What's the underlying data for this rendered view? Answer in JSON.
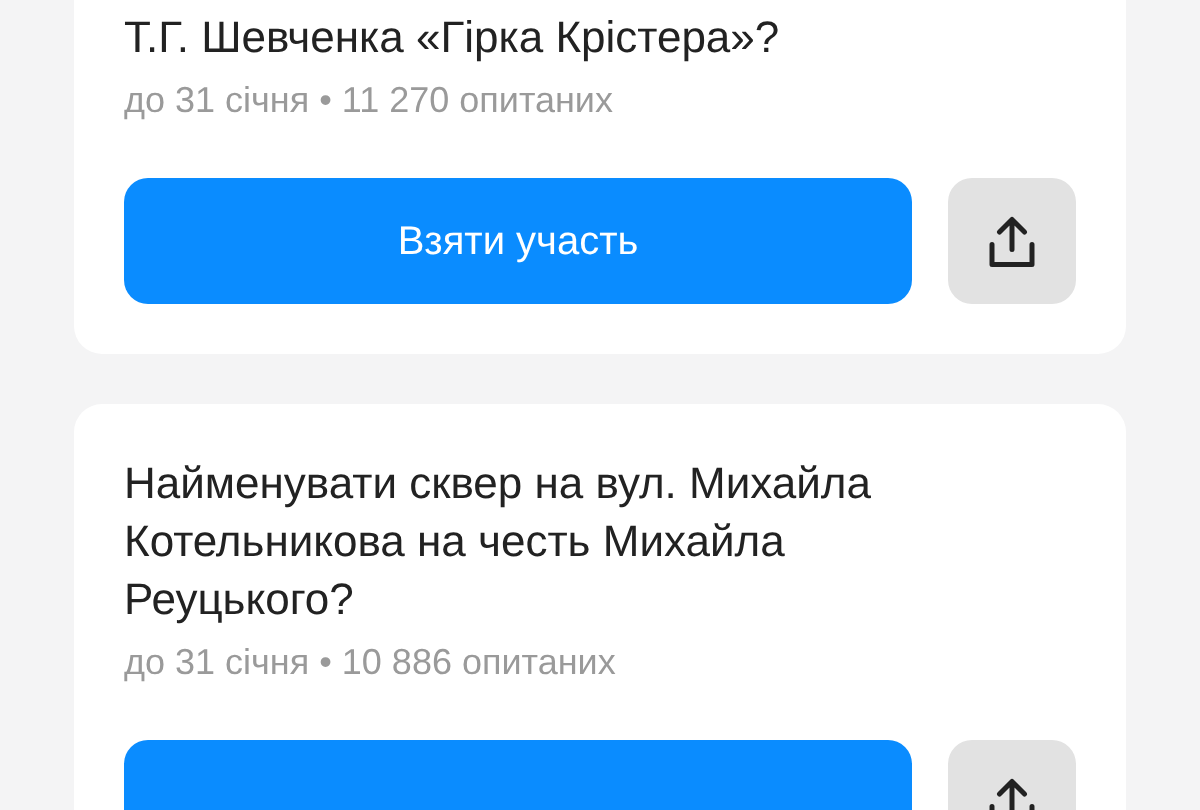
{
  "polls": [
    {
      "title": "Т.Г. Шевченка «Гірка Крістера»?",
      "meta": "до 31 січня • 11 270 опитаних",
      "action": "Взяти участь"
    },
    {
      "title": "Найменувати сквер на вул. Михайла Котельникова на честь Михайла Реуцького?",
      "meta": "до 31 січня • 10 886 опитаних"
    }
  ]
}
